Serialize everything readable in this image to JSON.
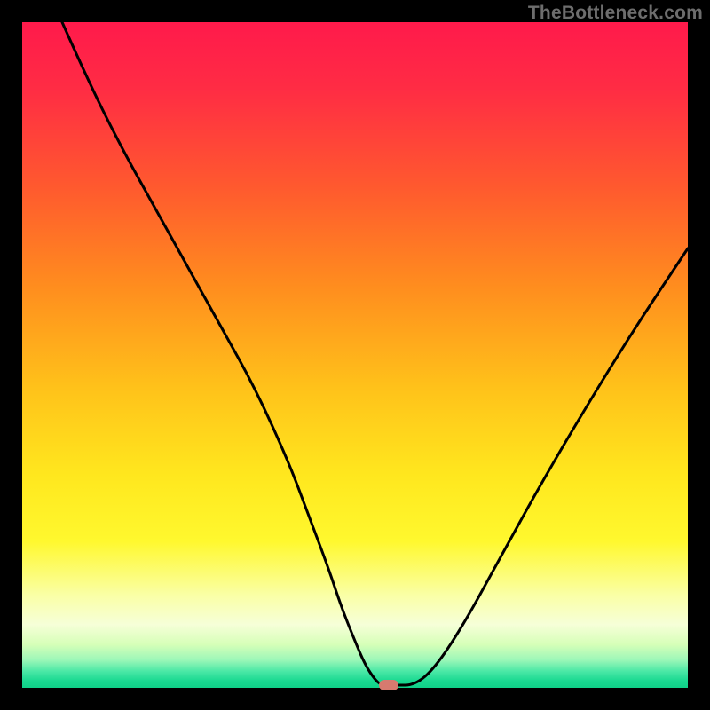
{
  "watermark": "TheBottleneck.com",
  "chart_data": {
    "type": "line",
    "title": "",
    "xlabel": "",
    "ylabel": "",
    "xlim": [
      0,
      100
    ],
    "ylim": [
      0,
      100
    ],
    "gradient_stops": [
      {
        "offset": 0.0,
        "color": "#ff1a4b"
      },
      {
        "offset": 0.1,
        "color": "#ff2c44"
      },
      {
        "offset": 0.25,
        "color": "#ff5a2e"
      },
      {
        "offset": 0.4,
        "color": "#ff8e1e"
      },
      {
        "offset": 0.55,
        "color": "#ffc21a"
      },
      {
        "offset": 0.68,
        "color": "#ffe71e"
      },
      {
        "offset": 0.78,
        "color": "#fff82e"
      },
      {
        "offset": 0.86,
        "color": "#faffa5"
      },
      {
        "offset": 0.905,
        "color": "#f6ffd8"
      },
      {
        "offset": 0.935,
        "color": "#d6ffb8"
      },
      {
        "offset": 0.958,
        "color": "#9cf7b8"
      },
      {
        "offset": 0.975,
        "color": "#4be8a6"
      },
      {
        "offset": 0.99,
        "color": "#18d890"
      },
      {
        "offset": 1.0,
        "color": "#10d088"
      }
    ],
    "series": [
      {
        "name": "bottleneck-curve",
        "x": [
          6,
          10,
          15,
          20,
          25,
          30,
          35,
          40,
          43,
          46,
          48,
          50,
          51.5,
          53,
          54,
          55,
          56,
          59,
          62,
          66,
          71,
          77,
          84,
          92,
          100
        ],
        "y": [
          100,
          91,
          81,
          72,
          63,
          54,
          45,
          34,
          26,
          18,
          12,
          7,
          3.5,
          1.2,
          0.4,
          0.4,
          0.4,
          0.4,
          3,
          9,
          18,
          29,
          41,
          54,
          66
        ]
      }
    ],
    "marker": {
      "x": 55,
      "y": 0.4,
      "color": "#d77a6f"
    },
    "annotations": []
  }
}
